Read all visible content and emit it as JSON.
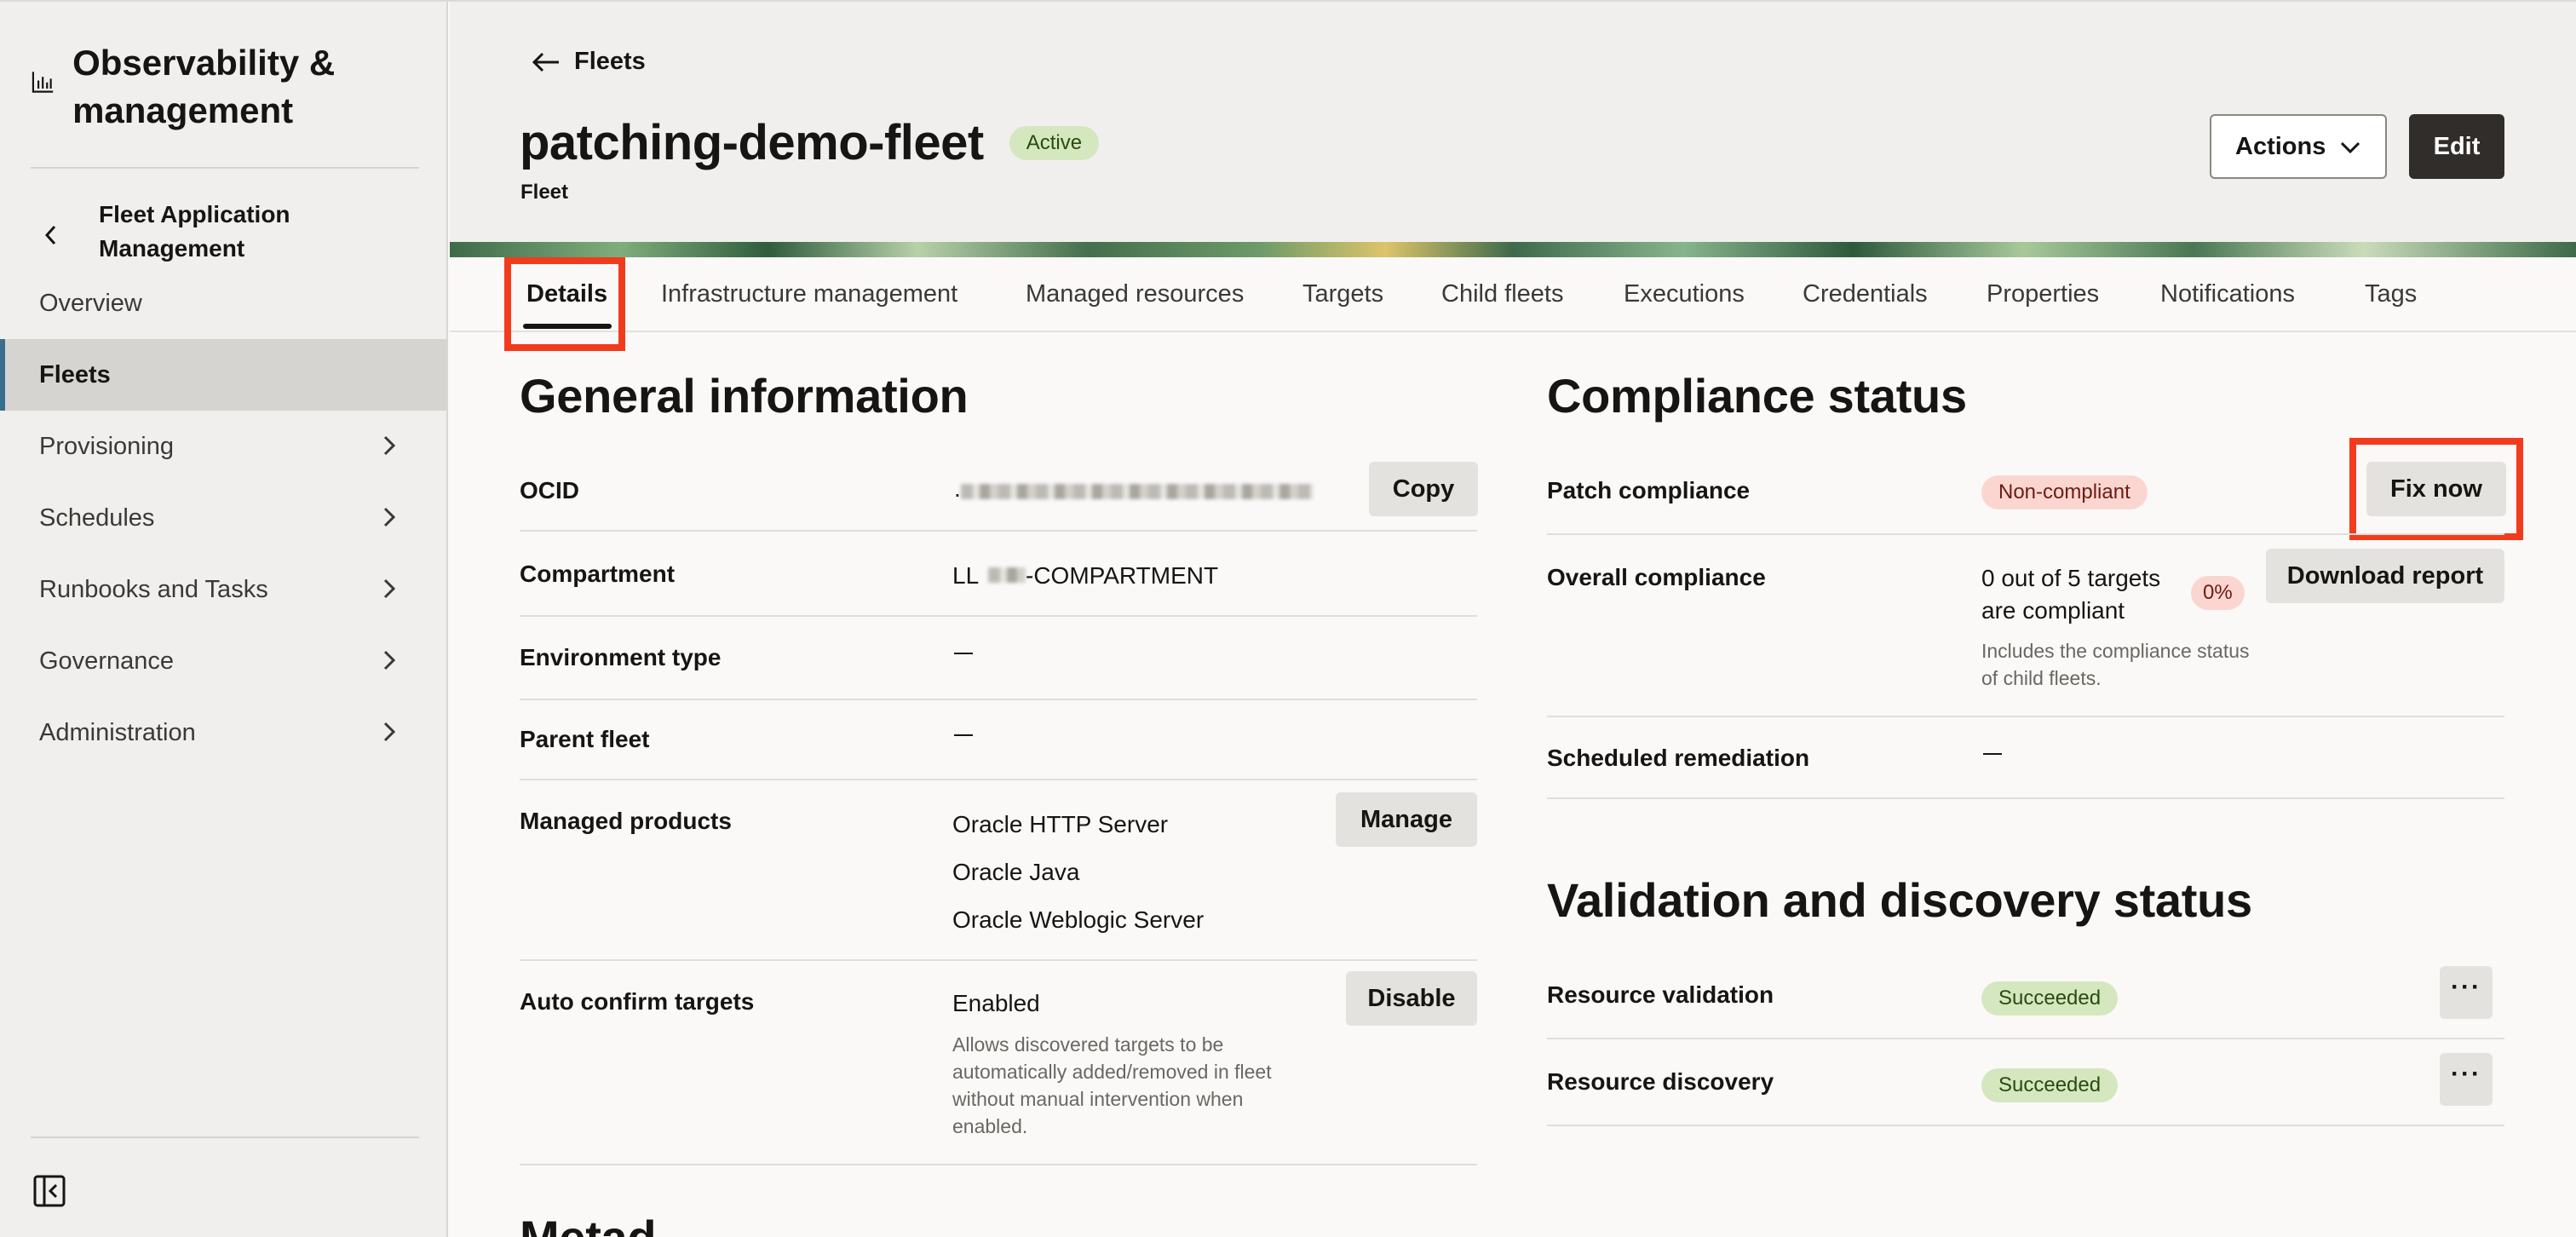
{
  "sidebar": {
    "brand_title": "Observability & management",
    "section_title": "Fleet Application Management",
    "items": [
      {
        "label": "Overview",
        "active": false,
        "has_chevron": false
      },
      {
        "label": "Fleets",
        "active": true,
        "has_chevron": false
      },
      {
        "label": "Provisioning",
        "active": false,
        "has_chevron": true
      },
      {
        "label": "Schedules",
        "active": false,
        "has_chevron": true
      },
      {
        "label": "Runbooks and Tasks",
        "active": false,
        "has_chevron": true
      },
      {
        "label": "Governance",
        "active": false,
        "has_chevron": true
      },
      {
        "label": "Administration",
        "active": false,
        "has_chevron": true
      }
    ]
  },
  "header": {
    "back_label": "Fleets",
    "title": "patching-demo-fleet",
    "status_badge": "Active",
    "subtitle": "Fleet",
    "actions_label": "Actions",
    "edit_label": "Edit"
  },
  "tabs": [
    "Details",
    "Infrastructure management",
    "Managed resources",
    "Targets",
    "Child fleets",
    "Executions",
    "Credentials",
    "Properties",
    "Notifications",
    "Tags"
  ],
  "active_tab": "Details",
  "general": {
    "heading": "General information",
    "ocid_label": "OCID",
    "ocid_value_prefix": ".",
    "copy_label": "Copy",
    "compartment_label": "Compartment",
    "compartment_value_start": "LL",
    "compartment_value_end": "-COMPARTMENT",
    "environment_label": "Environment type",
    "parent_label": "Parent fleet",
    "products_label": "Managed products",
    "products": [
      "Oracle HTTP Server",
      "Oracle Java",
      "Oracle Weblogic Server"
    ],
    "manage_label": "Manage",
    "auto_confirm_label": "Auto confirm targets",
    "auto_confirm_value": "Enabled",
    "auto_confirm_note": "Allows discovered targets to be automatically added/removed in fleet without manual intervention when enabled.",
    "disable_label": "Disable",
    "next_heading_partial": "Metad"
  },
  "compliance": {
    "heading": "Compliance status",
    "patch_label": "Patch compliance",
    "patch_badge": "Non-compliant",
    "fix_label": "Fix now",
    "overall_label": "Overall compliance",
    "overall_value": "0 out of 5 targets are compliant",
    "overall_percent": "0%",
    "overall_note": "Includes the compliance status of child fleets.",
    "download_label": "Download report",
    "remediation_label": "Scheduled remediation"
  },
  "validation": {
    "heading": "Validation and discovery status",
    "rows": [
      {
        "label": "Resource validation",
        "status": "Succeeded"
      },
      {
        "label": "Resource discovery",
        "status": "Succeeded"
      }
    ],
    "more_label": "···"
  },
  "colors": {
    "highlight": "#f23b1c",
    "success_badge": "#d4e7be",
    "danger_badge": "#fbd6d1",
    "active_nav_accent": "#3a6e8f"
  }
}
